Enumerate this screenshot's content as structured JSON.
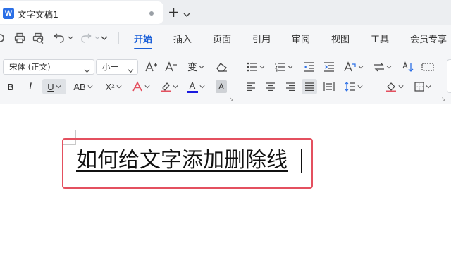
{
  "tabbar": {
    "app_logo": "W",
    "doc_title": "文字文稿1",
    "new_tab_icon": "plus-icon",
    "menu_icon": "chevron-down-icon"
  },
  "menubar": {
    "quick_access": [
      "print-icon",
      "print-preview-icon",
      "undo-icon",
      "redo-icon",
      "more-icon"
    ],
    "tabs": [
      {
        "label": "开始",
        "active": true
      },
      {
        "label": "插入"
      },
      {
        "label": "页面"
      },
      {
        "label": "引用"
      },
      {
        "label": "审阅"
      },
      {
        "label": "视图"
      },
      {
        "label": "工具"
      },
      {
        "label": "会员专享"
      }
    ],
    "accent": "#1a5fd8"
  },
  "ribbon": {
    "font_name": "宋体 (正文)",
    "font_size": "小一",
    "buttons": {
      "bold": "B",
      "italic": "I",
      "underline": "U",
      "superscript": "X²",
      "font_color": "A",
      "char_shading": "A",
      "grow_font": "A⁺",
      "shrink_font": "A⁻",
      "pinyin": "变"
    },
    "font_color_bar": "#1a1adf"
  },
  "document": {
    "text": "如何给文字添加删除线",
    "highlight_color": "#e4505f"
  }
}
